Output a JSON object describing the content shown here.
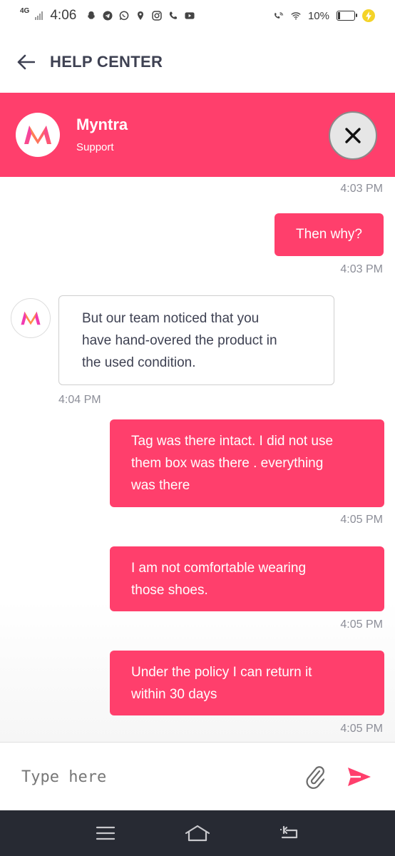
{
  "status_bar": {
    "network": "4G",
    "time": "4:06",
    "battery_percent": "10%",
    "icons": [
      "snapchat-icon",
      "telegram-icon",
      "whatsapp-icon",
      "location-icon",
      "instagram-icon",
      "phone-icon",
      "youtube-icon",
      "wifi-call-icon",
      "wifi-icon",
      "battery-icon",
      "charging-icon"
    ]
  },
  "header": {
    "title": "HELP CENTER",
    "back_icon": "arrow-left-icon"
  },
  "brand_band": {
    "background": "#ff3f6c",
    "name": "Myntra",
    "subtitle": "Support",
    "close_icon": "close-icon"
  },
  "chat": {
    "accent": "#ff3f6c",
    "messages": [
      {
        "from": "user",
        "text": "",
        "time": "4:03 PM"
      },
      {
        "from": "user",
        "text": "Then why?",
        "time": "4:03 PM"
      },
      {
        "from": "support",
        "lines": [
          "But our team noticed that you",
          "have hand-overed the product in",
          "the used condition."
        ],
        "time": "4:04 PM"
      },
      {
        "from": "user",
        "lines": [
          "Tag was there intact. I did not use",
          "them box was there . everything",
          "was there"
        ],
        "time": "4:05 PM"
      },
      {
        "from": "user",
        "lines": [
          "I am not comfortable wearing",
          "those shoes."
        ],
        "time": "4:05 PM"
      },
      {
        "from": "user",
        "lines": [
          "Under the policy I can return it",
          "within 30 days"
        ],
        "time": "4:05 PM"
      }
    ]
  },
  "composer": {
    "placeholder": "Type here",
    "value": "",
    "attach_icon": "paperclip-icon",
    "send_icon": "send-icon"
  },
  "nav_bar": {
    "icons": [
      "menu-icon",
      "home-icon",
      "back-icon"
    ]
  }
}
